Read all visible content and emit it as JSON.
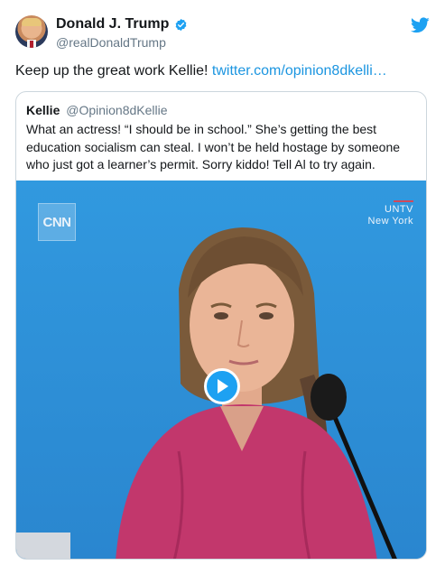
{
  "author": {
    "display_name": "Donald J. Trump",
    "handle": "@realDonaldTrump",
    "avatar_icon": "profile-photo",
    "verified_icon": "verified-badge-icon",
    "verified_color": "#1da1f2"
  },
  "brand": {
    "icon": "twitter-bird-icon",
    "color": "#1da1f2"
  },
  "tweet": {
    "text": "Keep up the great work Kellie!",
    "link": "twitter.com/opinion8dkelli…",
    "link_color": "#1b95e0"
  },
  "quoted_tweet": {
    "name": "Kellie",
    "handle": "@Opinion8dKellie",
    "text": "What an actress! “I should be in school.” She’s getting the best education socialism can steal. I won’t be held hostage by someone who just got a learner’s permit. Sorry kiddo! Tell Al to try again.",
    "media": {
      "cnn_logo": "CNN",
      "network_line1": "UNTV",
      "network_line2": "New York",
      "play_icon": "play-icon"
    }
  }
}
